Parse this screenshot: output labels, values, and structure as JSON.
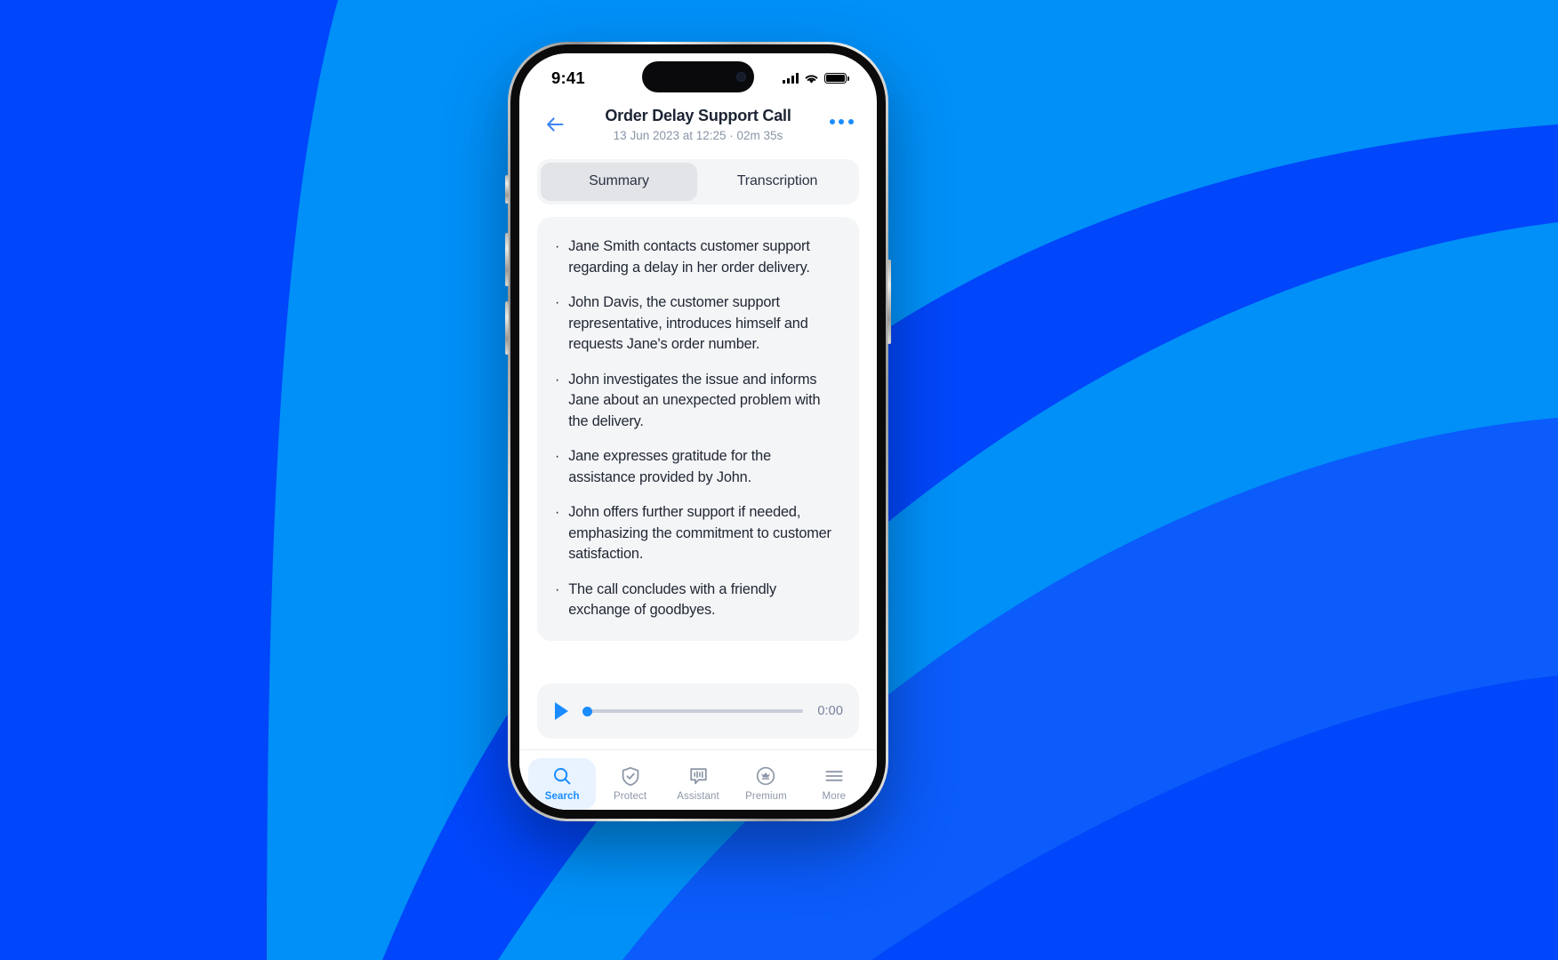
{
  "background": {
    "base_color": "#0046fa",
    "accent_color": "#0090f8"
  },
  "device": {
    "status_bar": {
      "time": "9:41",
      "signal_icon": "cellular-signal-icon",
      "wifi_icon": "wifi-icon",
      "battery_icon": "battery-icon"
    }
  },
  "header": {
    "back_icon": "back-arrow-icon",
    "title": "Order Delay Support Call",
    "subtitle": "13 Jun 2023 at 12:25 · 02m 35s",
    "more_icon": "more-options-icon"
  },
  "tabs": {
    "items": [
      {
        "label": "Summary",
        "active": true
      },
      {
        "label": "Transcription",
        "active": false
      }
    ]
  },
  "summary": {
    "bullet_glyph": "·",
    "points": [
      "Jane Smith contacts customer support regarding a delay in her order delivery.",
      "John Davis, the customer support representative, introduces himself and requests Jane's order number.",
      "John investigates the issue and informs Jane about an unexpected problem with the delivery.",
      "Jane expresses gratitude for the assistance provided by John.",
      "John offers further support if needed, emphasizing the commitment to customer satisfaction.",
      "The call concludes with a friendly exchange of goodbyes."
    ]
  },
  "player": {
    "play_icon": "play-icon",
    "current_time": "0:00",
    "progress_percent": 0,
    "accent_color": "#1a8cff"
  },
  "tabbar": {
    "items": [
      {
        "label": "Search",
        "icon": "search-icon",
        "active": true
      },
      {
        "label": "Protect",
        "icon": "shield-check-icon",
        "active": false
      },
      {
        "label": "Assistant",
        "icon": "voice-waveform-icon",
        "active": false
      },
      {
        "label": "Premium",
        "icon": "crown-badge-icon",
        "active": false
      },
      {
        "label": "More",
        "icon": "hamburger-menu-icon",
        "active": false
      }
    ]
  }
}
